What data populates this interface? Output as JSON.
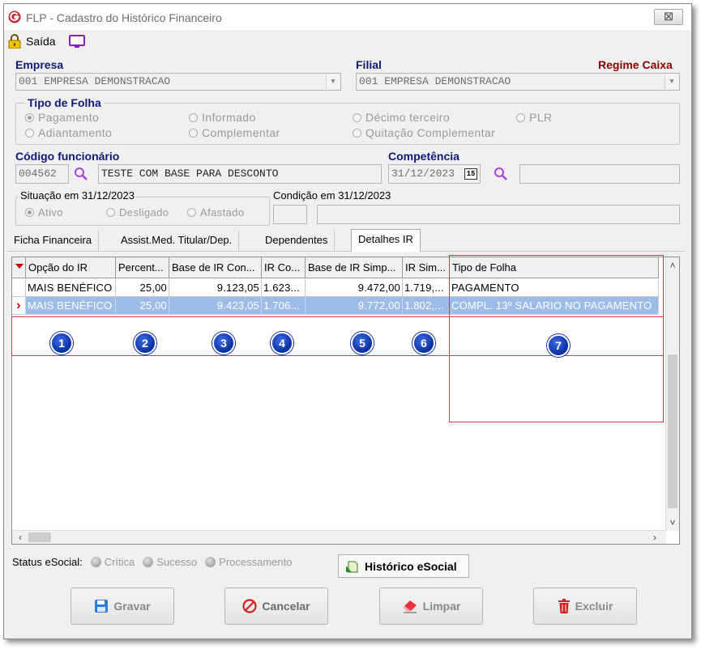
{
  "window": {
    "title": "FLP - Cadastro do Histórico Financeiro",
    "close_label": "⊠"
  },
  "toolbar": {
    "saida_label": "Saída"
  },
  "empresa": {
    "label": "Empresa",
    "value": "001 EMPRESA DEMONSTRACAO"
  },
  "filial": {
    "label": "Filial",
    "value": "001 EMPRESA DEMONSTRACAO",
    "regime": "Regime Caixa"
  },
  "tipo_folha": {
    "title": "Tipo de Folha",
    "options": [
      "Pagamento",
      "Informado",
      "Décimo terceiro",
      "PLR",
      "Adiantamento",
      "Complementar",
      "Quitação Complementar"
    ],
    "selected": "Pagamento"
  },
  "funcionario": {
    "label": "Código funcionário",
    "code": "004562",
    "name": "TESTE COM BASE PARA DESCONTO"
  },
  "competencia": {
    "label": "Competência",
    "value": "31/12/2023",
    "calendar_label": "15"
  },
  "situacao": {
    "title": "Situação em  31/12/2023",
    "options": [
      "Ativo",
      "Desligado",
      "Afastado"
    ],
    "selected": "Ativo"
  },
  "condicao": {
    "title": "Condição em 31/12/2023"
  },
  "tabs": [
    "Ficha Financeira",
    "Assist.Med. Titular/Dep.",
    "Dependentes",
    "Detalhes IR"
  ],
  "active_tab": "Detalhes IR",
  "grid": {
    "columns": [
      "Opção do IR",
      "Percent...",
      "Base de IR Con...",
      "IR Co...",
      "Base de IR Simp...",
      "IR Sim...",
      "Tipo de Folha"
    ],
    "rows": [
      [
        "MAIS BENÉFICO",
        "25,00",
        "9.123,05",
        "1.623...",
        "9.472,00",
        "1.719,...",
        "PAGAMENTO"
      ],
      [
        "MAIS BENÉFICO",
        "25,00",
        "9.423,05",
        "1.706...",
        "9.772,00",
        "1.802,...",
        "COMPL. 13º SALARIO NO PAGAMENTO"
      ]
    ],
    "selected_row": 1,
    "row_marker": "›"
  },
  "badges": [
    "1",
    "2",
    "3",
    "4",
    "5",
    "6",
    "7"
  ],
  "status_esocial": {
    "label": "Status eSocial:",
    "items": [
      "Crítica",
      "Sucesso",
      "Processamento"
    ],
    "historico": "Histórico eSocial"
  },
  "buttons": {
    "gravar": "Gravar",
    "cancelar": "Cancelar",
    "limpar": "Limpar",
    "excluir": "Excluir"
  },
  "colors": {
    "label_blue": "#0d1a78",
    "regime_red": "#8b0000",
    "selection": "#9dbce8",
    "highlight_box": "#d9363e",
    "badge": "#0a2f9e"
  }
}
